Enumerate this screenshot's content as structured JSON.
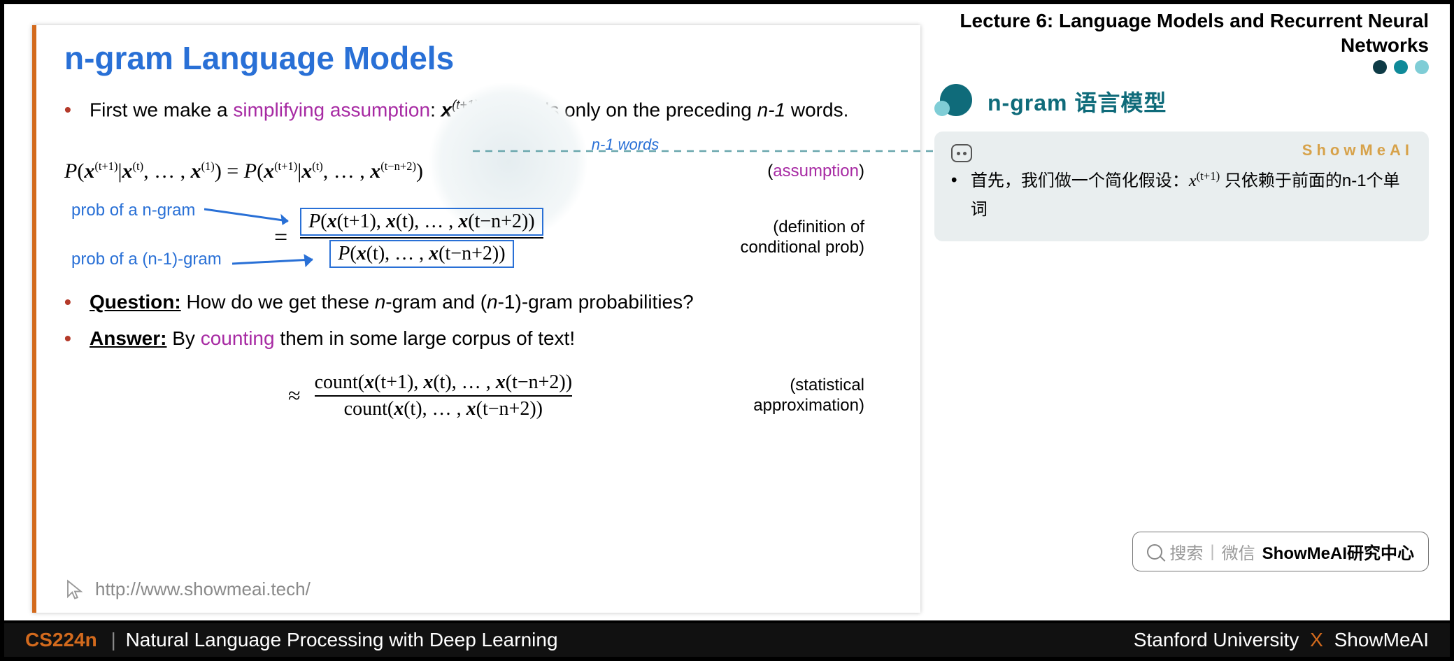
{
  "lecture_header": "Lecture 6:  Language Models and Recurrent Neural Networks",
  "dots_colors": [
    "#0e3b46",
    "#0f8a99",
    "#7fcdd6"
  ],
  "section_title_cn": "n-gram 语言模型",
  "slide": {
    "title": "n-gram Language Models",
    "bullet1_a": "First we make a ",
    "bullet1_assump": "simplifying assumption",
    "bullet1_b": ": ",
    "bullet1_x": "x",
    "bullet1_sup": "(t+1)",
    "bullet1_c": " depends only on the preceding ",
    "bullet1_n1": "n-1",
    "bullet1_d": " words.",
    "n1words": "n-1 words",
    "formula1": "P(𝒙^(t+1) | 𝒙^(t), … , 𝒙^(1)) = P(𝒙^(t+1) | 𝒙^(t), … , 𝒙^(t−n+2))",
    "note_assumption_open": "(",
    "note_assumption": "assumption",
    "note_assumption_close": ")",
    "label_ngram": "prob of a n-gram",
    "label_n1gram": "prob of a (n-1)-gram",
    "frac_num": "P(𝒙^(t+1), 𝒙^(t), … , 𝒙^(t−n+2))",
    "frac_den": "P(𝒙^(t), … , 𝒙^(t−n+2))",
    "def_note": "(definition of conditional prob)",
    "question_label": "Question:",
    "question_text": " How do we get these ",
    "question_n": "n",
    "question_mid": "-gram and (",
    "question_n2": "n",
    "question_end": "-1)-gram probabilities?",
    "answer_label": "Answer:",
    "answer_a": " By ",
    "answer_counting": "counting",
    "answer_b": " them in some large corpus of text!",
    "approx_sign": "≈",
    "count_num": "count(𝒙^(t+1), 𝒙^(t), … , 𝒙^(t−n+2))",
    "count_den": "count(𝒙^(t), … , 𝒙^(t−n+2))",
    "stat_note": "(statistical approximation)",
    "footer_url": "http://www.showmeai.tech/"
  },
  "card": {
    "brand": "ShowMeAI",
    "line_a": "首先，我们做一个简化假设：",
    "line_x": "x",
    "line_sup": "(t+1)",
    "line_b": "  只依赖于前面的n-1个单词"
  },
  "search": {
    "prefix": "搜索",
    "sep": "|",
    "wechat": "微信",
    "name": "ShowMeAI研究中心"
  },
  "footer": {
    "course": "CS224n",
    "pipe": "|",
    "subtitle": "Natural Language Processing with Deep Learning",
    "uni": "Stanford University",
    "x": "X",
    "org": "ShowMeAI"
  }
}
